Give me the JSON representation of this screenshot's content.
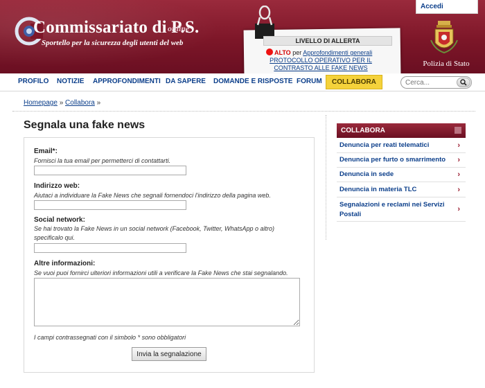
{
  "header": {
    "logo_title": "Commissariato di P.S.",
    "logo_online": "online",
    "logo_subtitle": "Sportello per la sicurezza degli utenti del web",
    "alert_title": "LIVELLO DI ALLERTA",
    "alert_level": "ALTO",
    "alert_per": "per",
    "alert_link": "Approfondimenti generali",
    "alert_protocol": "PROTOCOLLO OPERATIVO PER IL CONTRASTO ALLE FAKE NEWS",
    "login_label": "Accedi",
    "brand": "Polizia di Stato",
    "brand_color": "#7d1628"
  },
  "nav": {
    "items": [
      "PROFILO",
      "NOTIZIE",
      "APPROFONDIMENTI",
      "DA SAPERE",
      "DOMANDE E RISPOSTE",
      "FORUM",
      "COLLABORA"
    ],
    "active": "COLLABORA",
    "search_placeholder": "Cerca..."
  },
  "breadcrumb": {
    "home": "Homepage",
    "separator": "»",
    "current": "Collabora"
  },
  "main": {
    "title": "Segnala una fake news",
    "fields": [
      {
        "label": "Email*:",
        "help": "Fornisci la tua email per permetterci di contattarti.",
        "value": ""
      },
      {
        "label": "Indirizzo web:",
        "help": "Aiutaci a individuare la Fake News che segnali fornendoci l'indirizzo della pagina web.",
        "value": ""
      },
      {
        "label": "Social network:",
        "help": "Se hai trovato la Fake News in un social network (Facebook, Twitter, WhatsApp o altro) specificalo qui.",
        "value": ""
      },
      {
        "label": "Altre informazioni:",
        "help": "Se vuoi puoi fornirci ulteriori informazioni utili a verificare la Fake News che stai segnalando.",
        "value": ""
      }
    ],
    "mandatory_note": "I campi contrassegnati con il simbolo * sono obbligatori",
    "submit_label": "Invia la segnalazione"
  },
  "sidebar": {
    "title": "COLLABORA",
    "items": [
      "Denuncia per reati telematici",
      "Denuncia per furto o smarrimento",
      "Denuncia in sede",
      "Denuncia in materia TLC",
      "Segnalazioni e reclami nei Servizi Postali"
    ],
    "arrow": "›"
  }
}
